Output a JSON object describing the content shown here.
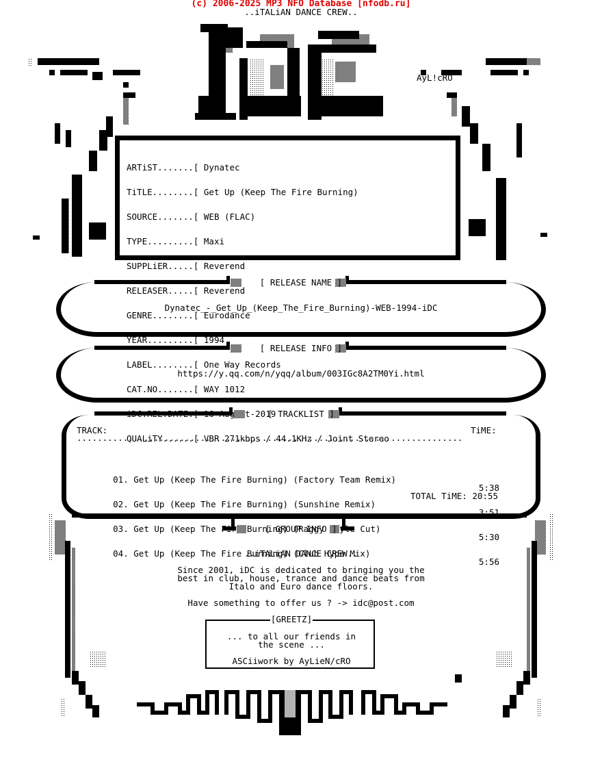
{
  "header": {
    "credit": "(c) 2006-2025 MP3 NFO Database [nfodb.ru]",
    "group_tagline": "..iTALiAN DANCE CREW..",
    "logo_text": "iDC",
    "artist_tag": "AyL!cRO"
  },
  "info": {
    "rows": [
      {
        "label": "ARTiST.......[",
        "value": "Dynatec"
      },
      {
        "label": "TiTLE........[",
        "value": "Get Up (Keep The Fire Burning)"
      },
      {
        "label": "SOURCE.......[",
        "value": "WEB (FLAC)"
      },
      {
        "label": "TYPE.........[",
        "value": "Maxi"
      },
      {
        "label": "SUPPLiER.....[",
        "value": "Reverend"
      },
      {
        "label": "RELEASER.....[",
        "value": "Reverend"
      },
      {
        "label": "GENRE........[",
        "value": "Eurodance"
      },
      {
        "label": "YEAR.........[",
        "value": "1994"
      },
      {
        "label": "LABEL........[",
        "value": "One Way Records"
      },
      {
        "label": "CAT.NO.......[",
        "value": "WAY 1012"
      },
      {
        "label": "iDC.REL.DATE.[",
        "value": "16-August-2019"
      },
      {
        "label": "QUALiTY......[",
        "value": "VBR 271kbps / 44.1KHz / Joint Stereo"
      }
    ]
  },
  "release_name": {
    "title": "[ RELEASE NAME ]",
    "value": "Dynatec_-_Get_Up_(Keep_The_Fire_Burning)-WEB-1994-iDC"
  },
  "release_info": {
    "title": "[ RELEASE INFO ]",
    "value": "https://y.qq.com/n/yqq/album/003IGc8A2TM0Yi.html"
  },
  "tracklist": {
    "title": "[ TRACKLIST ]",
    "col_track": "TRACK:",
    "col_time": "TiME:",
    "separator": "...........................................................................",
    "tracks": [
      {
        "num": "01.",
        "title": "Get Up (Keep The Fire Burning) (Factory Team Remix)",
        "time": "5:38"
      },
      {
        "num": "02.",
        "title": "Get Up (Keep The Fire Burning) (Sunshine Remix)",
        "time": "3:51"
      },
      {
        "num": "03.",
        "title": "Get Up (Keep The Fire Burning) (Raggy Style Cut)",
        "time": "5:30"
      },
      {
        "num": "04.",
        "title": "Get Up (Keep The Fire Burning) (Club Hype Mix)",
        "time": "5:56"
      }
    ],
    "total_label": "TOTAL TiME:",
    "total_time": "20:55"
  },
  "group_info": {
    "title": "[ GROUP INFO ]",
    "tagline": "..iTALiAN DANCE CREW..",
    "description": [
      "Since 2001, iDC is dedicated to bringing you the",
      "best in club, house, trance and dance beats from",
      "Italo and Euro dance floors."
    ],
    "contact": "Have something to offer us ? -> idc@post.com"
  },
  "greetz": {
    "title": "[GREETZ]",
    "lines": [
      "... to all our friends in",
      "the scene ..."
    ],
    "credit": "ASCiiwork by AyLieN/cRO"
  }
}
